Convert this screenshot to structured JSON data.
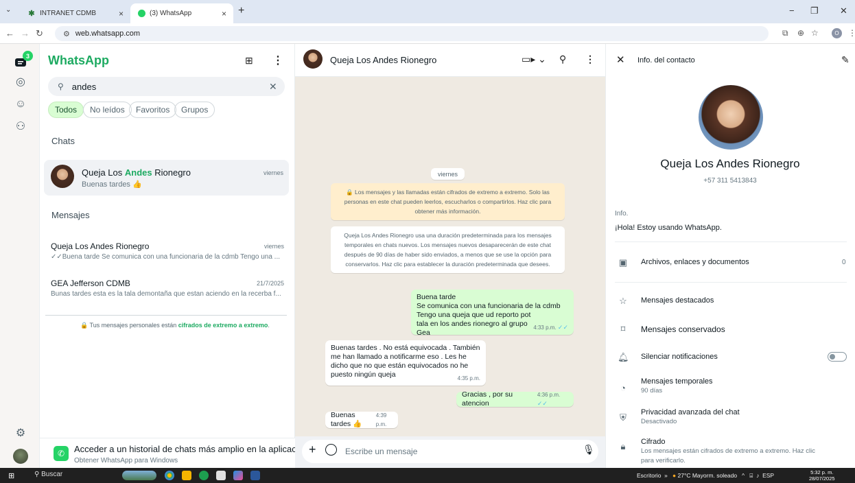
{
  "browser": {
    "tabs": [
      {
        "title": "INTRANET CDMB",
        "close": "×"
      },
      {
        "title": "(3) WhatsApp",
        "close": "×"
      }
    ],
    "new_tab": "+",
    "url": "web.whatsapp.com",
    "profile_initial": "O",
    "controls": {
      "minimize": "−",
      "restore": "❐",
      "close": "✕"
    }
  },
  "rail": {
    "unread_badge": "3",
    "icons": [
      "chats-icon",
      "status-icon",
      "channels-icon",
      "communities-icon",
      "settings-icon"
    ]
  },
  "sidebar": {
    "app_title": "WhatsApp",
    "search_value": "andes",
    "filters": [
      "Todos",
      "No leídos",
      "Favoritos",
      "Grupos"
    ],
    "chats_heading": "Chats",
    "chat": {
      "name_before": "Queja Los ",
      "name_match": "Andes",
      "name_after": " Rionegro",
      "preview": "Buenas tardes 👍",
      "time": "viernes"
    },
    "messages_heading": "Mensajes",
    "message_results": [
      {
        "name": "Queja Los Andes Rionegro",
        "time": "viernes",
        "text": "✓✓Buena tarde  Se comunica con una funcionaria de la cdmb Tengo una ..."
      },
      {
        "name": "GEA Jefferson CDMB",
        "time": "21/7/2025",
        "text": "Bunas tardes esta es la tala demontaña que estan  aciendo en la recerba f..."
      }
    ],
    "e2e_note_prefix": "Tus mensajes personales están ",
    "e2e_note_link": "cifrados de extremo a extremo",
    "e2e_note_suffix": ".",
    "promo_title": "Acceder a un historial de chats más amplio en la aplicación",
    "promo_subtitle": "Obtener WhatsApp para Windows"
  },
  "conversation": {
    "contact_name": "Queja Los Andes Rionegro",
    "date_pill": "viernes",
    "system_e2e": "🔒 Los mensajes y las llamadas están cifrados de extremo a extremo. Solo las personas en este chat pueden leerlos, escucharlos o compartirlos. Haz clic para obtener más información.",
    "system_timer": "Queja Los Andes Rionegro usa una duración predeterminada para los mensajes temporales en chats nuevos. Los mensajes nuevos desaparecerán de este chat después de 90 días de haber sido enviados, a menos que se use la opción para conservarlos. Haz clic para establecer la duración predeterminada que desees.",
    "messages": [
      {
        "direction": "out",
        "lines": [
          "Buena tarde",
          "Se comunica con una funcionaria de la cdmb",
          "Tengo una queja que ud reporto pot tala en los andes rionegro al grupo Gea"
        ],
        "time": "4:33 p.m.",
        "ticks": "✓✓"
      },
      {
        "direction": "in",
        "lines": [
          "Buenas tardes . No está equivocada . También me han llamado a notificarme eso . Les he dicho que no que están equivocados no he puesto ningún queja"
        ],
        "time": "4:35 p.m."
      },
      {
        "direction": "out",
        "lines": [
          "Gracias , por su atencion"
        ],
        "time": "4:36 p.m.",
        "ticks": "✓✓"
      },
      {
        "direction": "in",
        "lines": [
          "Buenas tardes 👍"
        ],
        "time": "4:39 p.m."
      }
    ],
    "composer_placeholder": "Escribe un mensaje"
  },
  "contact_info": {
    "header_title": "Info. del contacto",
    "name": "Queja Los Andes Rionegro",
    "phone": "+57 311 5413843",
    "about_label": "Info.",
    "about_text": "¡Hola! Estoy usando WhatsApp.",
    "files_label": "Archivos, enlaces y documentos",
    "files_count": "0",
    "starred_label": "Mensajes destacados",
    "kept_label": "Mensajes conservados",
    "mute_label": "Silenciar notificaciones",
    "mute_on": false,
    "disappearing_label": "Mensajes temporales",
    "disappearing_value": "90 días",
    "privacy_label": "Privacidad avanzada del chat",
    "privacy_value": "Desactivado",
    "encryption_label": "Cifrado",
    "encryption_value_1": "Los mensajes están cifrados de extremo a extremo. Haz clic",
    "encryption_value_2": "para verificarlo."
  },
  "taskbar": {
    "search": "Buscar",
    "desktop": "Escritorio",
    "weather": "27°C  Mayorm. soleado",
    "lang": "ESP",
    "time": "5:32 p. m.",
    "date": "28/07/2025"
  },
  "colors": {
    "brand_green": "#1daa61",
    "outgoing_bubble": "#d9fdd3",
    "chat_background": "#efeae2",
    "read_ticks": "#53bdeb"
  }
}
